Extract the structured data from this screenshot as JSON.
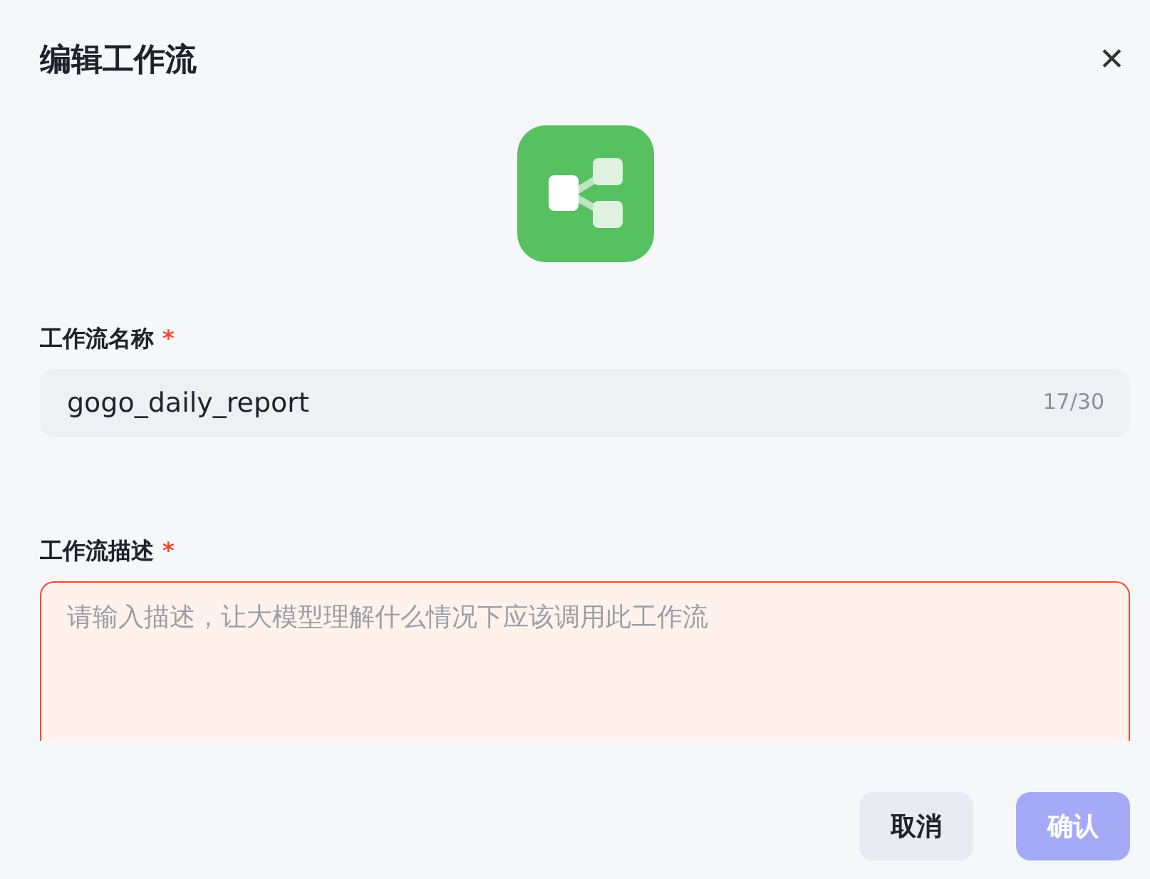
{
  "dialog": {
    "title": "编辑工作流",
    "close": "✕"
  },
  "fields": [
    {
      "kind": "input",
      "label": "工作流名称",
      "required_mark": "*",
      "value": "gogo_daily_report",
      "counter": "17/30",
      "error": false
    },
    {
      "kind": "textarea",
      "label": "工作流描述",
      "required_mark": "*",
      "placeholder": "请输入描述，让大模型理解什么情况下应该调用此工作流",
      "error": true
    }
  ],
  "buttons": [
    {
      "label": "取消",
      "kind": "secondary",
      "disabled": false
    },
    {
      "label": "确认",
      "kind": "primary",
      "disabled": true
    }
  ]
}
